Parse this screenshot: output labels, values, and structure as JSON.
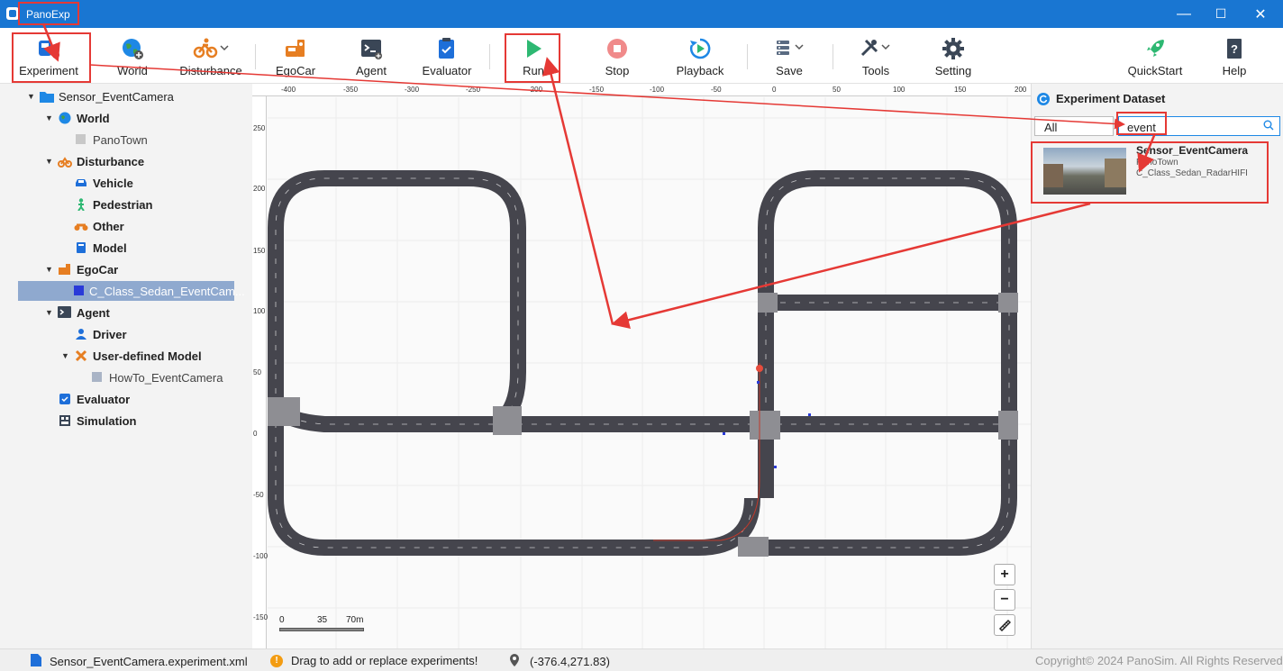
{
  "window": {
    "title": "PanoExp",
    "controls": {
      "minimize": "—",
      "maximize": "☐",
      "close": "✕"
    }
  },
  "toolbar": {
    "experiment": "Experiment",
    "world": "World",
    "disturbance": "Disturbance",
    "egocar": "EgoCar",
    "agent": "Agent",
    "evaluator": "Evaluator",
    "run": "Run",
    "stop": "Stop",
    "playback": "Playback",
    "save": "Save",
    "tools": "Tools",
    "setting": "Setting",
    "quickstart": "QuickStart",
    "help": "Help"
  },
  "tree": {
    "root": "Sensor_EventCamera",
    "world": "World",
    "world_map": "PanoTown",
    "disturbance": "Disturbance",
    "vehicle": "Vehicle",
    "pedestrian": "Pedestrian",
    "other": "Other",
    "model": "Model",
    "egocar": "EgoCar",
    "egocar_item": "C_Class_Sedan_EventCam...",
    "agent": "Agent",
    "driver": "Driver",
    "user_model": "User-defined Model",
    "user_model_item": "HowTo_EventCamera",
    "evaluator": "Evaluator",
    "simulation": "Simulation"
  },
  "map": {
    "ruler_x": [
      "-400",
      "-350",
      "-300",
      "-250",
      "-200",
      "-150",
      "-100",
      "-50",
      "0",
      "50",
      "100",
      "150",
      "200"
    ],
    "ruler_y": [
      "250",
      "200",
      "150",
      "100",
      "50",
      "0",
      "-50",
      "-100",
      "-150"
    ],
    "scale_labels": [
      "0",
      "35",
      "70m"
    ],
    "zoom_in": "+",
    "zoom_out": "−"
  },
  "dataset": {
    "title": "Experiment Dataset",
    "filter": "All",
    "search_value": "event",
    "item": {
      "name": "Sensor_EventCamera",
      "map": "PanoTown",
      "vehicle": "C_Class_Sedan_RadarHIFI"
    }
  },
  "status": {
    "file": "Sensor_EventCamera.experiment.xml",
    "hint": "Drag to add or replace experiments!",
    "coords": "(-376.4,271.83)",
    "copyright": "Copyright© 2024 PanoSim. All Rights Reserved"
  },
  "colors": {
    "titlebar": "#1976d2",
    "road": "#45454d",
    "selection": "#8fa9cf",
    "annotation": "#e53935",
    "run": "#2eb872",
    "stop": "#f08a8a"
  }
}
